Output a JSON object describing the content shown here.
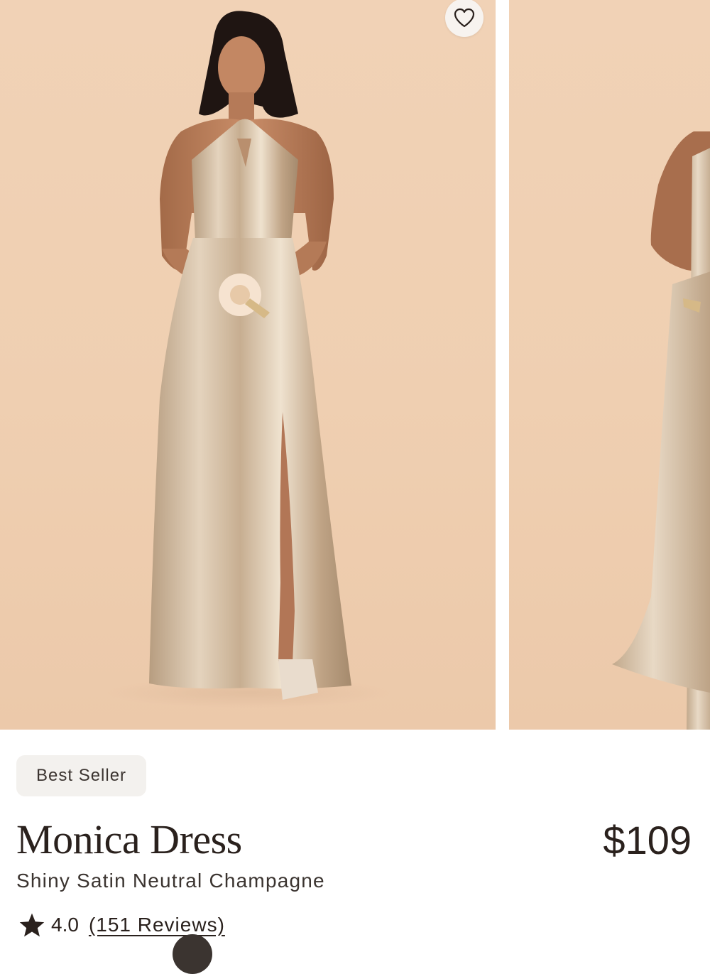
{
  "product": {
    "badge": "Best Seller",
    "name": "Monica Dress",
    "price": "$109",
    "variant": "Shiny Satin Neutral Champagne",
    "rating": "4.0",
    "reviews_label": "(151 Reviews)"
  },
  "gallery": {
    "images": [
      {
        "alt": "model-front-view"
      },
      {
        "alt": "model-side-view"
      }
    ]
  },
  "icons": {
    "favorite": "heart-icon",
    "star": "star-icon",
    "chat": "chat-icon"
  },
  "colors": {
    "backdrop": "#efcfb1",
    "dress": "#c9b397",
    "text": "#2a211d",
    "badge_bg": "#f3f1ee"
  }
}
